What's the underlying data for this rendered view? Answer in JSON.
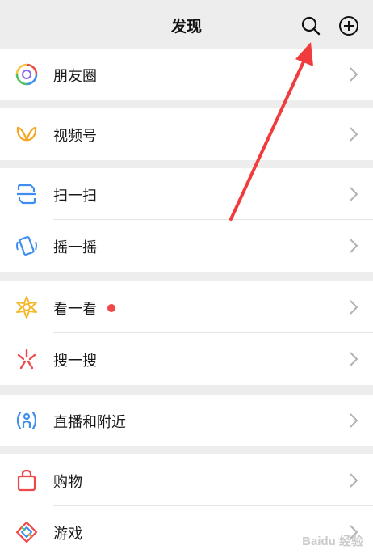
{
  "header": {
    "title": "发现",
    "search_icon": "search-icon",
    "add_icon": "plus-circle-icon"
  },
  "groups": [
    {
      "items": [
        {
          "label": "朋友圈",
          "icon": "moments-icon"
        }
      ]
    },
    {
      "items": [
        {
          "label": "视频号",
          "icon": "channels-icon"
        }
      ]
    },
    {
      "items": [
        {
          "label": "扫一扫",
          "icon": "scan-icon"
        },
        {
          "label": "摇一摇",
          "icon": "shake-icon"
        }
      ]
    },
    {
      "items": [
        {
          "label": "看一看",
          "icon": "top-stories-icon",
          "badge": "red-dot"
        },
        {
          "label": "搜一搜",
          "icon": "search-feature-icon"
        }
      ]
    },
    {
      "items": [
        {
          "label": "直播和附近",
          "icon": "live-nearby-icon"
        }
      ]
    },
    {
      "items": [
        {
          "label": "购物",
          "icon": "shopping-bag-icon"
        },
        {
          "label": "游戏",
          "icon": "games-icon"
        }
      ]
    }
  ],
  "colors": {
    "accent_red": "#f04848",
    "background": "#ededed",
    "annotation_arrow": "#f03c3c"
  },
  "watermark": "Baidu 经验"
}
